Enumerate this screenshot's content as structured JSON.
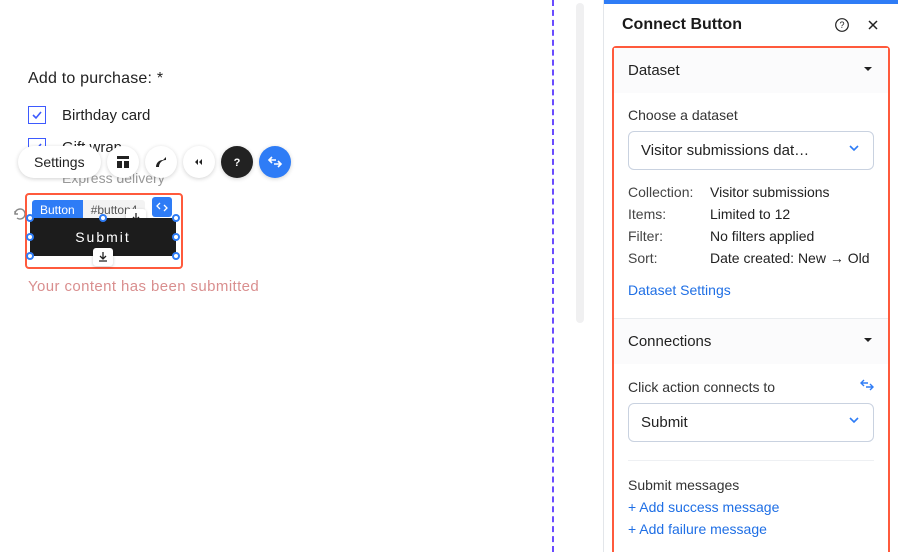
{
  "form": {
    "title": "Add to purchase:  *",
    "items": [
      {
        "label": "Birthday card",
        "checked": true
      },
      {
        "label": "Gift wrap",
        "checked": true
      },
      {
        "label": "Express delivery",
        "checked": false
      }
    ]
  },
  "toolbar": {
    "settings_label": "Settings"
  },
  "selected": {
    "tag_type": "Button",
    "tag_id": "#button4",
    "button_label": "Submit"
  },
  "status_message": "Your content has been submitted",
  "panel": {
    "title": "Connect Button",
    "dataset": {
      "section_label": "Dataset",
      "choose_label": "Choose a dataset",
      "selected_dataset": "Visitor submissions dat…",
      "meta": {
        "collection_k": "Collection:",
        "collection_v": "Visitor submissions",
        "items_k": "Items:",
        "items_v": "Limited to 12",
        "filter_k": "Filter:",
        "filter_v": "No filters applied",
        "sort_k": "Sort:",
        "sort_v": "Date created: New → Old"
      },
      "settings_link": "Dataset Settings"
    },
    "connections": {
      "section_label": "Connections",
      "click_label": "Click action connects to",
      "selected_action": "Submit",
      "submit_messages_label": "Submit messages",
      "add_success": "+ Add success message",
      "add_failure": "+ Add failure message"
    }
  }
}
